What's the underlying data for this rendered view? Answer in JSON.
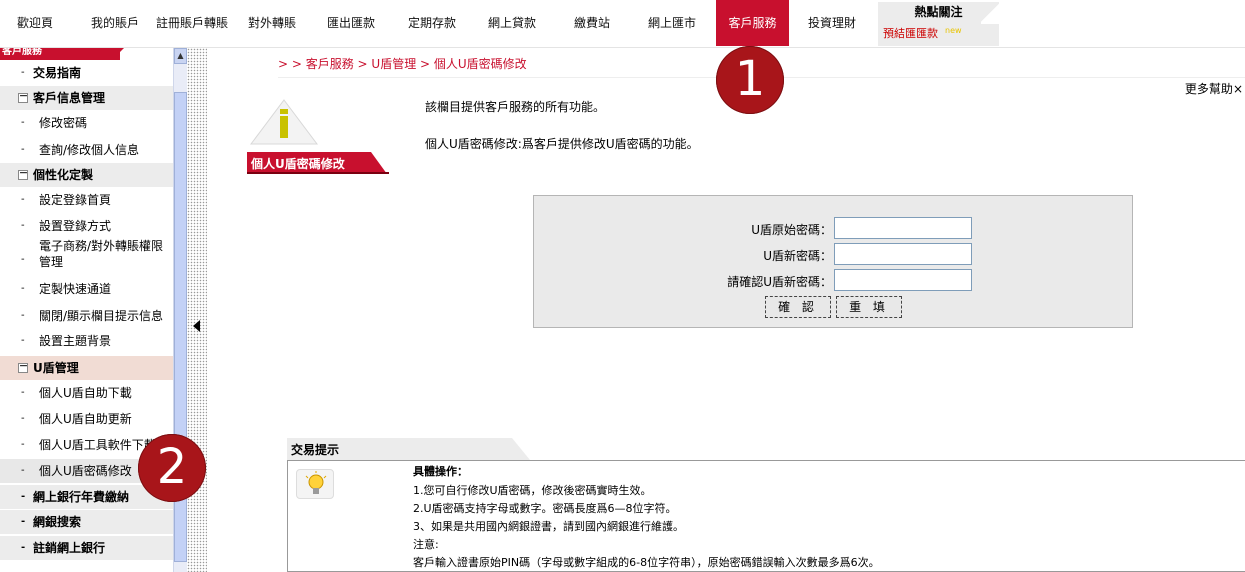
{
  "nav": {
    "items": [
      {
        "label": "歡迎頁"
      },
      {
        "label": "我的賬戶"
      },
      {
        "label": "註冊賬戶轉賬"
      },
      {
        "label": "對外轉賬"
      },
      {
        "label": "匯出匯款"
      },
      {
        "label": "定期存款"
      },
      {
        "label": "網上貸款"
      },
      {
        "label": "繳費站"
      },
      {
        "label": "網上匯市"
      },
      {
        "label": "客戶服務",
        "active": true
      },
      {
        "label": "投資理財"
      }
    ],
    "hot": {
      "title": "熱點關注",
      "link": "預結匯匯款",
      "new_tag": "new"
    }
  },
  "sidebar": {
    "header": "客戶服務",
    "items": [
      {
        "type": "top",
        "label": "交易指南"
      },
      {
        "type": "sec",
        "box": "－",
        "label": "客戶信息管理"
      },
      {
        "type": "leaf",
        "label": "修改密碼"
      },
      {
        "type": "leaf",
        "label": "查詢/修改個人信息"
      },
      {
        "type": "sec",
        "box": "－",
        "label": "個性化定製"
      },
      {
        "type": "leaf",
        "label": "設定登錄首頁"
      },
      {
        "type": "leaf",
        "label": "設置登錄方式"
      },
      {
        "type": "leaf2",
        "label": "電子商務/對外轉賬權限",
        "label2": "管理"
      },
      {
        "type": "leaf",
        "label": "定製快速通道"
      },
      {
        "type": "leaf",
        "label": "關閉/顯示欄目提示信息"
      },
      {
        "type": "leaf",
        "label": "設置主題背景"
      },
      {
        "type": "sec",
        "box": "－",
        "label": "U盾管理"
      },
      {
        "type": "leaf",
        "label": "個人U盾自助下載"
      },
      {
        "type": "leaf",
        "label": "個人U盾自助更新"
      },
      {
        "type": "leaf",
        "label": "個人U盾工具軟件下載"
      },
      {
        "type": "leaf",
        "label": "個人U盾密碼修改",
        "selected": true
      },
      {
        "type": "top",
        "label": "網上銀行年費繳納"
      },
      {
        "type": "top",
        "label": "網銀搜索"
      },
      {
        "type": "top",
        "label": "註銷網上銀行"
      }
    ]
  },
  "main": {
    "breadcrumb": "> > 客戶服務 > U盾管理 > 個人U盾密碼修改",
    "more_help": "更多幫助",
    "close_glyph": "×",
    "title": "個人U盾密碼修改",
    "desc1": "該欄目提供客戶服務的所有功能。",
    "desc2": "個人U盾密碼修改:爲客戶提供修改U盾密碼的功能。",
    "form": {
      "old_label": "U盾原始密碼：",
      "new_label": "U盾新密碼：",
      "confirm_label": "請確認U盾新密碼：",
      "old_value": "",
      "new_value": "",
      "confirm_value": "",
      "confirm_button": "確 認",
      "reset_button": "重 填"
    },
    "tips": {
      "title": "交易提示",
      "lines": [
        "具體操作：",
        "1.您可自行修改U盾密碼，修改後密碼實時生效。",
        "2.U盾密碼支持字母或數字。密碼長度爲6—8位字符。",
        "3、如果是共用國內網銀證書，請到國內網銀進行維護。",
        "注意:",
        "客戶輸入證書原始PIN碼（字母或數字組成的6-8位字符串），原始密碼錯誤輸入次數最多爲6次。"
      ]
    }
  },
  "annotations": {
    "badge1": "1",
    "badge2": "2"
  },
  "colors": {
    "brand_red": "#c8102e",
    "badge_red": "#a8151a"
  }
}
